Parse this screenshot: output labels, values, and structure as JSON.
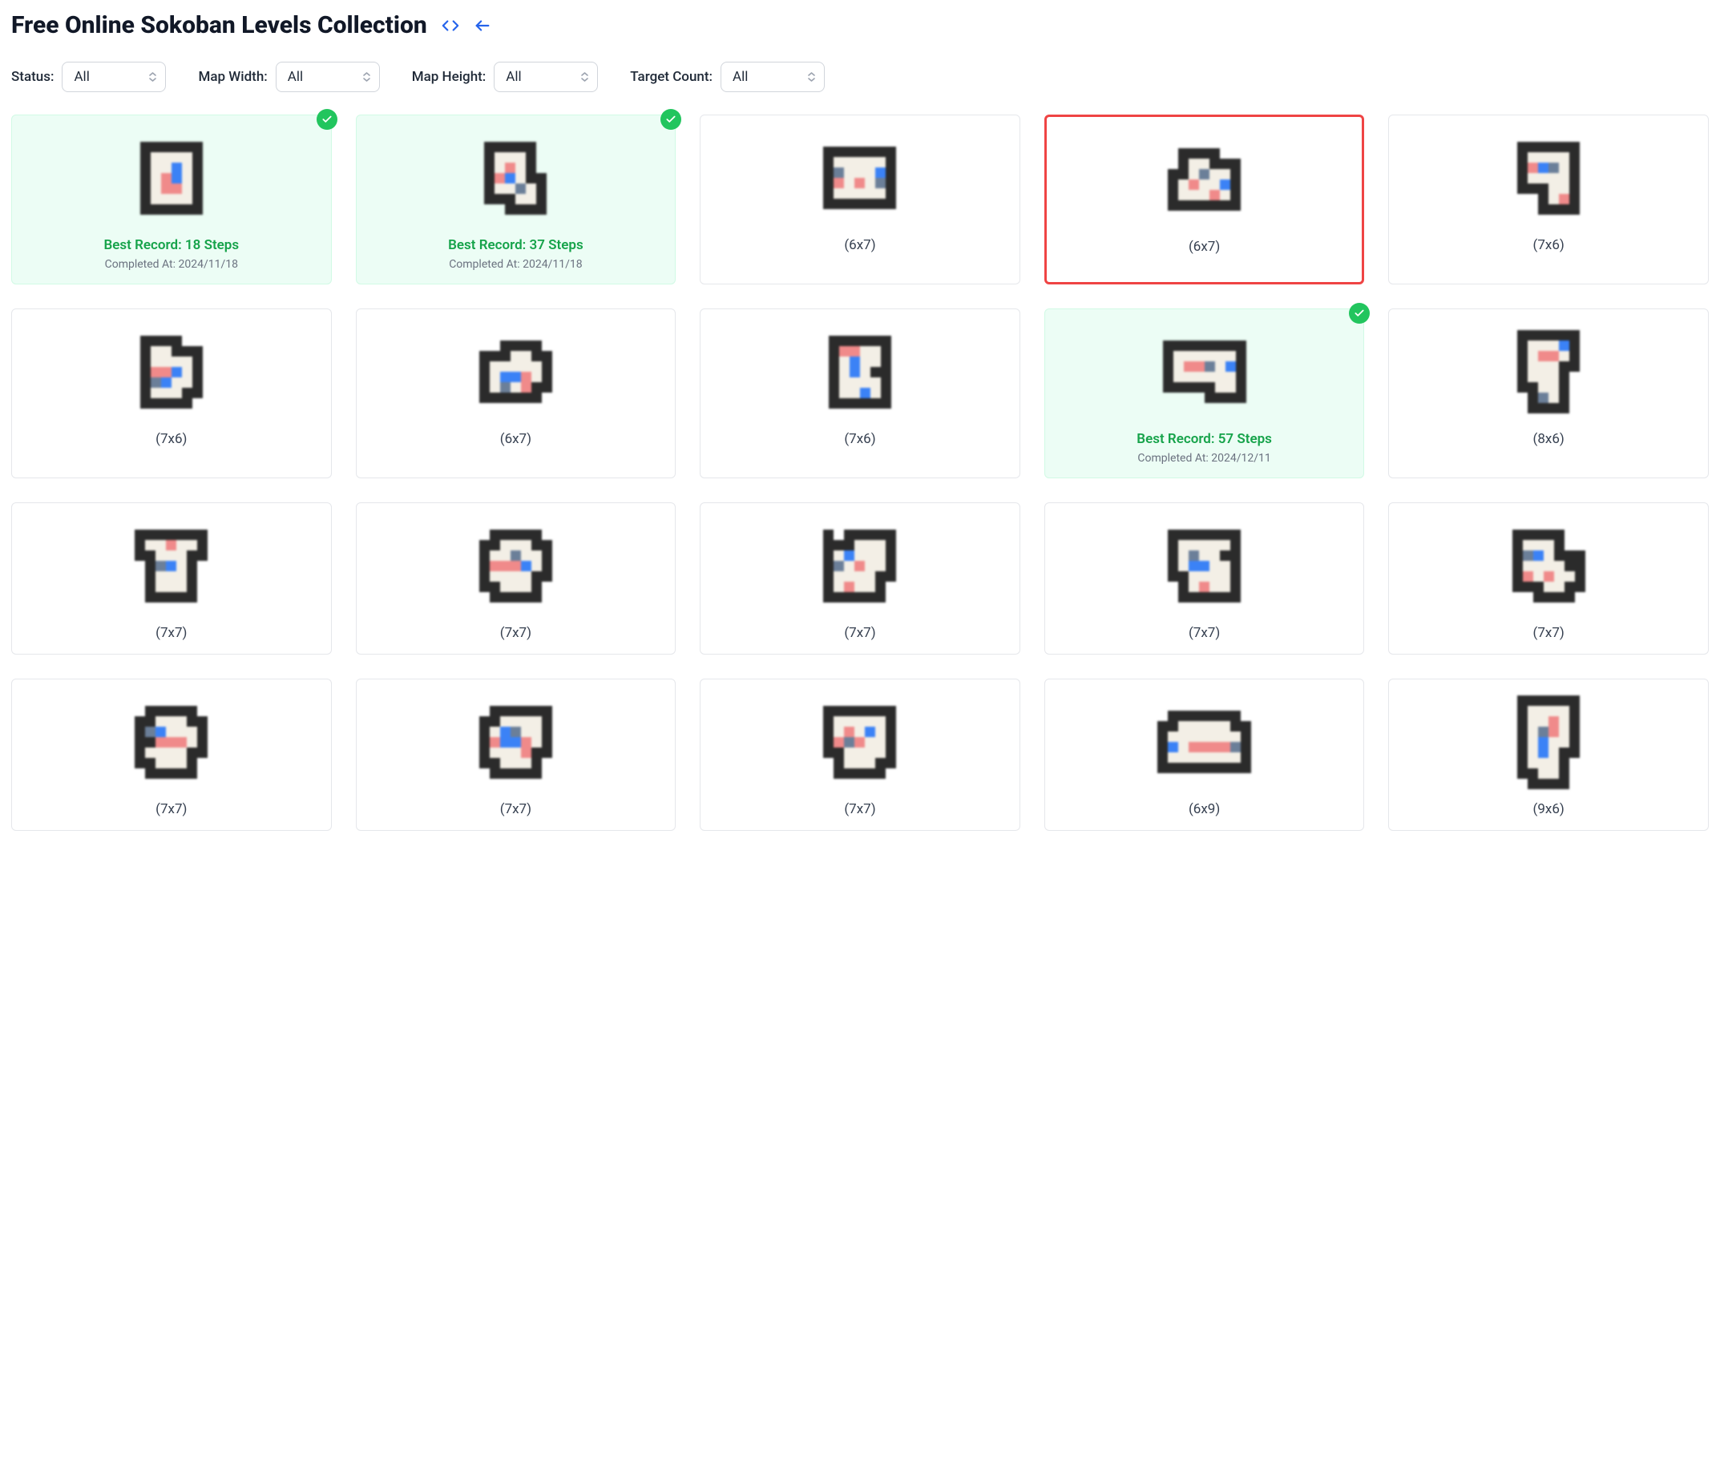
{
  "header": {
    "title": "Free Online Sokoban Levels Collection"
  },
  "filters": {
    "status_label": "Status:",
    "status_value": "All",
    "width_label": "Map Width:",
    "width_value": "All",
    "height_label": "Map Height:",
    "height_value": "All",
    "target_label": "Target Count:",
    "target_value": "All"
  },
  "levels": [
    {
      "dims": "",
      "completed": true,
      "selected": false,
      "record": "Best Record: 18 Steps",
      "completed_at": "Completed At: 2024/11/18",
      "grid": [
        "wwwwww",
        "wffffw",
        "wffbfw",
        "wftbfw",
        "wfttfw",
        "wffffw",
        "wwwwww"
      ]
    },
    {
      "dims": "",
      "completed": true,
      "selected": false,
      "record": "Best Record: 37 Steps",
      "completed_at": "Completed At: 2024/11/18",
      "grid": [
        "wwwwwe",
        "wfffwe",
        "wftfwe",
        "wtbfww",
        "wffdfw",
        "wwwffw",
        "eewwww"
      ]
    },
    {
      "dims": "(6x7)",
      "completed": false,
      "selected": false,
      "record": "",
      "completed_at": "",
      "grid": [
        "wwwwwww",
        "wfffffw",
        "wdfffbw",
        "wtftfdw",
        "wfffffw",
        "wwwwwww"
      ]
    },
    {
      "dims": "(6x7)",
      "completed": false,
      "selected": true,
      "record": "",
      "completed_at": "",
      "grid": [
        "ewwwwee",
        "ewffwww",
        "wwfdffw",
        "wftffbw",
        "wffftfw",
        "wwwwwww"
      ]
    },
    {
      "dims": "(7x6)",
      "completed": false,
      "selected": false,
      "record": "",
      "completed_at": "",
      "grid": [
        "wwwwww",
        "wffffw",
        "wtbdfw",
        "wffffw",
        "wwwffw",
        "eewftw",
        "eewwww"
      ]
    },
    {
      "dims": "(7x6)",
      "completed": false,
      "selected": false,
      "record": "",
      "completed_at": "",
      "grid": [
        "wwwwee",
        "wffwww",
        "wffffw",
        "wttbfw",
        "wdbffw",
        "wfffww",
        "wwwwwe"
      ]
    },
    {
      "dims": "(6x7)",
      "completed": false,
      "selected": false,
      "record": "",
      "completed_at": "",
      "grid": [
        "eewwwwe",
        "wwwffww",
        "wfffffw",
        "wfbbtfw",
        "wfdftww",
        "wwwwwwe"
      ]
    },
    {
      "dims": "(7x6)",
      "completed": false,
      "selected": false,
      "record": "",
      "completed_at": "",
      "grid": [
        "wwwwww",
        "wttffw",
        "wfbffw",
        "wfbfww",
        "wffffw",
        "wffbfw",
        "wwwwww"
      ]
    },
    {
      "dims": "",
      "completed": true,
      "selected": false,
      "record": "Best Record: 57 Steps",
      "completed_at": "Completed At: 2024/12/11",
      "grid": [
        "wwwwwwww",
        "wffffffw",
        "wfttdfbw",
        "wffffffw",
        "wwwwwffw",
        "eeeewwww"
      ]
    },
    {
      "dims": "(8x6)",
      "completed": false,
      "selected": false,
      "record": "",
      "completed_at": "",
      "grid": [
        "wwwwww",
        "wfffbw",
        "wfttfw",
        "wfffww",
        "wfffwe",
        "wwffwe",
        "ewdfwe",
        "ewwwwe"
      ]
    },
    {
      "dims": "(7x7)",
      "completed": false,
      "selected": false,
      "record": "",
      "completed_at": "",
      "grid": [
        "wwwwwww",
        "wfftffw",
        "wwfffww",
        "ewdbfwe",
        "ewfffwe",
        "ewfffwe",
        "ewwwwwe"
      ]
    },
    {
      "dims": "(7x7)",
      "completed": false,
      "selected": false,
      "record": "",
      "completed_at": "",
      "grid": [
        "ewwwwwe",
        "wwfffww",
        "wffdffw",
        "wtttbfw",
        "wffffww",
        "wwfffwe",
        "ewwwwwe"
      ]
    },
    {
      "dims": "(7x7)",
      "completed": false,
      "selected": false,
      "record": "",
      "completed_at": "",
      "grid": [
        "wewwwww",
        "wwwfffw",
        "wfbfffw",
        "wdftffw",
        "wffffww",
        "wftffwe",
        "wwwwwwe"
      ]
    },
    {
      "dims": "(7x7)",
      "completed": false,
      "selected": false,
      "record": "",
      "completed_at": "",
      "grid": [
        "wwwwwww",
        "wfffffw",
        "wfdffww",
        "wfbbffw",
        "wwffffw",
        "ewftffw",
        "ewwwwww"
      ]
    },
    {
      "dims": "(7x7)",
      "completed": false,
      "selected": false,
      "record": "",
      "completed_at": "",
      "grid": [
        "wwwwwee",
        "wfffwee",
        "wdbfwww",
        "wffffww",
        "wtftffw",
        "wwwffww",
        "eewwwwe"
      ]
    },
    {
      "dims": "(7x7)",
      "completed": false,
      "selected": false,
      "record": "",
      "completed_at": "",
      "grid": [
        "ewwwwwe",
        "wwfffww",
        "wdbfffw",
        "wwtttfw",
        "wffffww",
        "wwfffwe",
        "ewwwwwe"
      ]
    },
    {
      "dims": "(7x7)",
      "completed": false,
      "selected": false,
      "record": "",
      "completed_at": "",
      "grid": [
        "ewwwwww",
        "wwffffw",
        "wfbdffw",
        "wtbbtfw",
        "wffftww",
        "wwfffwe",
        "ewwwwwe"
      ]
    },
    {
      "dims": "(7x7)",
      "completed": false,
      "selected": false,
      "record": "",
      "completed_at": "",
      "grid": [
        "wwwwwww",
        "wfffffw",
        "wftfbfw",
        "wtdtffw",
        "wwffffw",
        "ewfffww",
        "ewwwwwe"
      ]
    },
    {
      "dims": "(6x9)",
      "completed": false,
      "selected": false,
      "record": "",
      "completed_at": "",
      "grid": [
        "ewwwwwwwe",
        "wwfffffww",
        "wfffffffw",
        "wbfttttdw",
        "wfffffffw",
        "wwwwwwwww"
      ]
    },
    {
      "dims": "(9x6)",
      "completed": false,
      "selected": false,
      "record": "",
      "completed_at": "",
      "grid": [
        "wwwwww",
        "wffffw",
        "wfftfw",
        "wfdtfw",
        "wfbffw",
        "wfbfww",
        "wfffwe",
        "wwffwe",
        "ewwwwe"
      ]
    }
  ]
}
